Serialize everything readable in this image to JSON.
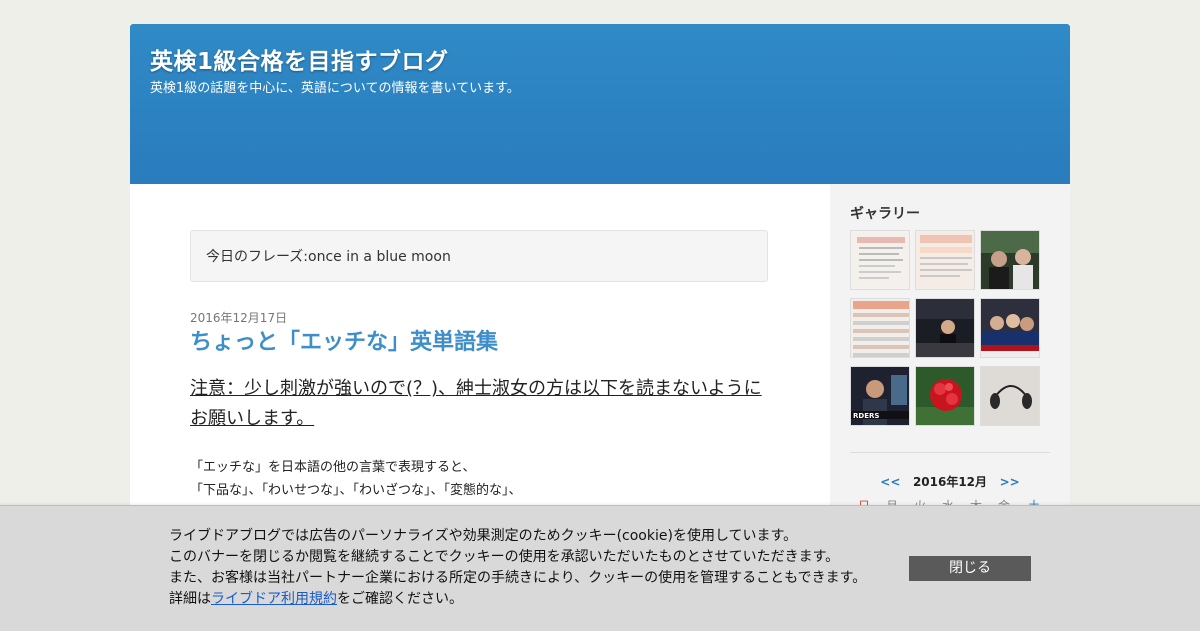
{
  "header": {
    "title": "英検1級合格を目指すブログ",
    "description": "英検1級の話題を中心に、英語についての情報を書いています。"
  },
  "phrase_box": {
    "text": "今日のフレーズ:once in a blue moon"
  },
  "post": {
    "date": "2016年12月17日",
    "title": "ちょっと「エッチな」英単語集",
    "notice_lines": [
      "注意：少し刺激が強いので(？)、紳士淑女の方は以下を読まないように",
      "お願いします。"
    ],
    "body_lines": [
      "「エッチな」を日本語の他の言葉で表現すると、",
      "「下品な」、「わいせつな」、「わいざつな」、「変態的な」、"
    ]
  },
  "sidebar": {
    "gallery_heading": "ギャラリー",
    "gallery_thumbnails": [
      "document-scan-thumbnail",
      "score-sheet-thumbnail",
      "people-photo-thumbnail",
      "table-screenshot-thumbnail",
      "press-conference-thumbnail",
      "news-group-thumbnail",
      "video-speaker-thumbnail",
      "red-flower-thumbnail",
      "earphones-thumbnail"
    ],
    "calendar": {
      "prev": "<<",
      "month_label": "2016年12月",
      "next": ">>"
    },
    "calendar_weekdays": [
      "日",
      "月",
      "火",
      "水",
      "木",
      "金",
      "土"
    ]
  },
  "cookie_banner": {
    "line1": "ライブドアブログでは広告のパーソナライズや効果測定のためクッキー(cookie)を使用しています。",
    "line2": "このバナーを閉じるか閲覧を継続することでクッキーの使用を承認いただいたものとさせていただきます。",
    "line3": "また、お客様は当社パートナー企業における所定の手続きにより、クッキーの使用を管理することもできます。",
    "line4_prefix": "詳細は",
    "link_text": "ライブドア利用規約",
    "line4_suffix": "をご確認ください。",
    "close_button": "閉じる"
  },
  "colors": {
    "header_blue": "#2f8ac6",
    "title_blue": "#3d8ec9",
    "page_bg": "#efefea"
  }
}
